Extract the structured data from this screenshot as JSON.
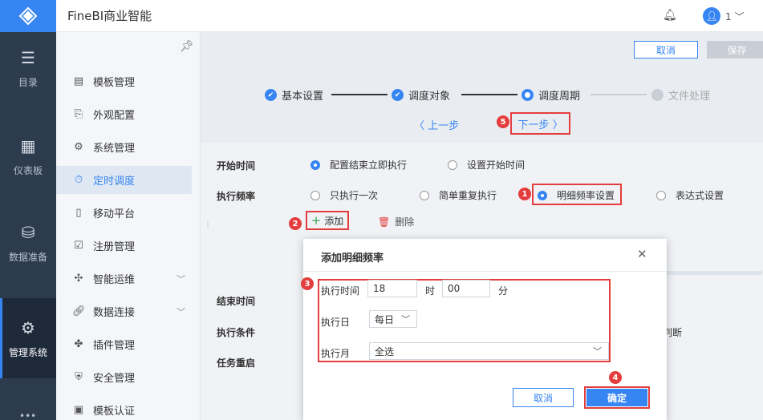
{
  "app_title": "FineBI商业智能",
  "header": {
    "user": "1"
  },
  "rail": {
    "items": [
      {
        "label": "目录"
      },
      {
        "label": "仪表板"
      },
      {
        "label": "数据准备"
      },
      {
        "label": "管理系统"
      }
    ]
  },
  "menu": {
    "items": [
      {
        "label": "模板管理"
      },
      {
        "label": "外观配置"
      },
      {
        "label": "系统管理"
      },
      {
        "label": "定时调度"
      },
      {
        "label": "移动平台"
      },
      {
        "label": "注册管理"
      },
      {
        "label": "智能运维"
      },
      {
        "label": "数据连接"
      },
      {
        "label": "插件管理"
      },
      {
        "label": "安全管理"
      },
      {
        "label": "模板认证"
      }
    ]
  },
  "toolbar": {
    "cancel": "取消",
    "save": "保存"
  },
  "steps": [
    {
      "label": "基本设置"
    },
    {
      "label": "调度对象"
    },
    {
      "label": "调度周期"
    },
    {
      "label": "文件处理"
    }
  ],
  "nav": {
    "prev": "上一步",
    "next": "下一步"
  },
  "form": {
    "start_label": "开始时间",
    "start_opt1": "配置结束立即执行",
    "start_opt2": "设置开始时间",
    "freq_label": "执行频率",
    "freq_opt1": "只执行一次",
    "freq_opt2": "简单重复执行",
    "freq_opt3": "明细频率设置",
    "freq_opt4": "表达式设置",
    "add": "添加",
    "delete": "删除",
    "end_label": "结束时间",
    "cond_label": "执行条件",
    "cond_tail": "判断",
    "retry_label": "任务重启"
  },
  "dialog": {
    "title": "添加明细频率",
    "exec_time_label": "执行时间",
    "hour": "18",
    "hour_unit": "时",
    "minute": "00",
    "minute_unit": "分",
    "exec_day_label": "执行日",
    "exec_day_value": "每日",
    "exec_month_label": "执行月",
    "exec_month_value": "全选",
    "cancel": "取消",
    "ok": "确定"
  },
  "badges": [
    "1",
    "2",
    "3",
    "4",
    "5"
  ],
  "colors": {
    "accent": "#3685f2",
    "annotation": "#e43d3d",
    "rail": "#2d3b4e"
  }
}
